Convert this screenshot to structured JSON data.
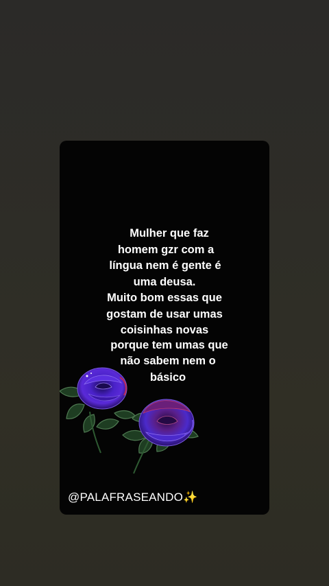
{
  "quote": {
    "lines": [
      "Mulher que faz",
      "homem gzr com a",
      "língua nem é gente é",
      "uma deusa.",
      "Muito bom essas que",
      "gostam de usar umas",
      "coisinhas novas",
      "porque tem umas que",
      "não sabem nem o",
      "básico"
    ]
  },
  "watermark": {
    "handle": "@PALAFRASEANDO✨"
  },
  "decoration": {
    "image": "purple-roses-illustration",
    "rose_color": "#3a1fa0",
    "leaf_color": "#1f3a22"
  }
}
